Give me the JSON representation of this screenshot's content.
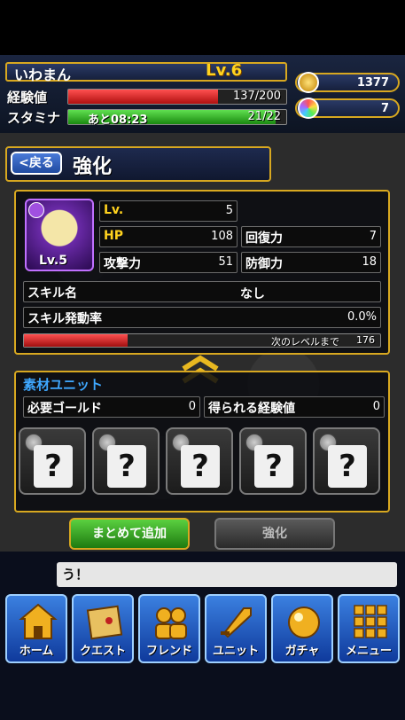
{
  "player": {
    "name": "いわまん",
    "level_label": "Lv.6",
    "exp_label": "経験値",
    "exp_value": "137/200",
    "exp_fraction": 0.685,
    "stamina_label": "スタミナ",
    "stamina_timer": "あと08:23",
    "stamina_value": "21/22",
    "stamina_fraction": 0.95
  },
  "currency": {
    "gold": "1377",
    "gems": "7"
  },
  "header": {
    "back_label": "<戻る",
    "title": "強化"
  },
  "unit": {
    "portrait_level": "Lv.5",
    "stats": {
      "lv_label": "Lv.",
      "lv_value": "5",
      "hp_label": "HP",
      "hp_value": "108",
      "recovery_label": "回復力",
      "recovery_value": "7",
      "attack_label": "攻撃力",
      "attack_value": "51",
      "defense_label": "防御力",
      "defense_value": "18"
    },
    "skill_name_label": "スキル名",
    "skill_name_value": "なし",
    "skill_rate_label": "スキル発動率",
    "skill_rate_value": "0.0%",
    "next_level_label": "次のレベルまで",
    "next_level_value": "176",
    "next_level_fraction": 0.29
  },
  "material": {
    "title": "素材ユニット",
    "gold_label": "必要ゴールド",
    "gold_value": "0",
    "exp_label": "得られる経験値",
    "exp_value": "0",
    "slots": [
      "?",
      "?",
      "?",
      "?",
      "?"
    ]
  },
  "actions": {
    "bulk_add": "まとめて追加",
    "enhance": "強化"
  },
  "message": "う！",
  "nav": [
    {
      "label": "ホーム",
      "icon": "home-icon"
    },
    {
      "label": "クエスト",
      "icon": "quest-map-icon"
    },
    {
      "label": "フレンド",
      "icon": "friends-icon"
    },
    {
      "label": "ユニット",
      "icon": "unit-sword-icon"
    },
    {
      "label": "ガチャ",
      "icon": "gacha-orb-icon"
    },
    {
      "label": "メニュー",
      "icon": "menu-grid-icon"
    }
  ],
  "colors": {
    "accent_gold": "#d8a820",
    "exp_bar": "#e02020",
    "stamina_bar": "#2ab820",
    "nav_blue": "#1f5ed0"
  }
}
